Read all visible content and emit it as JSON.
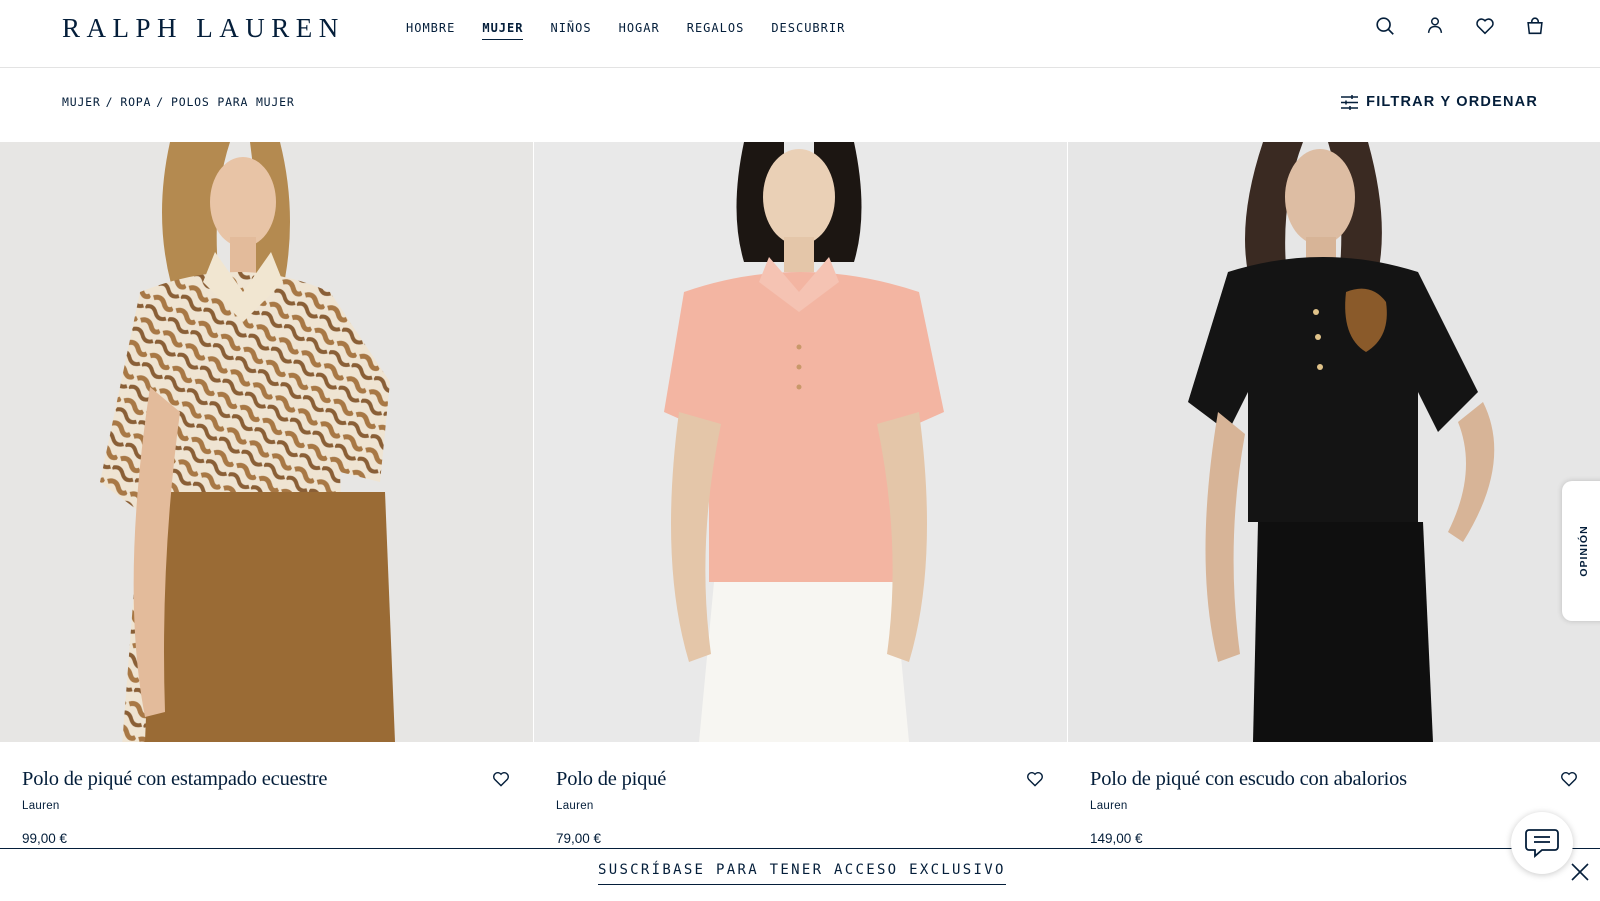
{
  "brand": {
    "logo_text": "RALPH LAUREN"
  },
  "nav": {
    "items": [
      {
        "label": "HOMBRE",
        "active": false
      },
      {
        "label": "MUJER",
        "active": true
      },
      {
        "label": "NIÑOS",
        "active": false
      },
      {
        "label": "HOGAR",
        "active": false
      },
      {
        "label": "REGALOS",
        "active": false
      },
      {
        "label": "DESCUBRIR",
        "active": false
      }
    ]
  },
  "header_icons": [
    "search-icon",
    "account-icon",
    "wishlist-heart-icon",
    "shopping-bag-icon"
  ],
  "breadcrumb": {
    "items": [
      "MUJER",
      "ROPA",
      "POLOS PARA MUJER"
    ],
    "separator": "/"
  },
  "filter": {
    "label": "FILTRAR Y ORDENAR",
    "icon": "sliders-icon"
  },
  "products": [
    {
      "name": "Polo de piqué con estampado ecuestre",
      "brand": "Lauren",
      "price": "99,00 €",
      "shirt_color": "#c89868",
      "pants_color": "#9a6b35"
    },
    {
      "name": "Polo de piqué",
      "brand": "Lauren",
      "price": "79,00 €",
      "shirt_color": "#f3b5a2",
      "pants_color": "#f7f6f2"
    },
    {
      "name": "Polo de piqué con escudo con abalorios",
      "brand": "Lauren",
      "price": "149,00 €",
      "shirt_color": "#141414",
      "pants_color": "#0f0f0f"
    }
  ],
  "feedback_tab": {
    "label": "OPINIÓN"
  },
  "promo": {
    "label": "SUSCRÍBASE PARA TENER ACCESO EXCLUSIVO"
  },
  "colors": {
    "navy": "#041e3a",
    "image_bg": "#e8e8e8",
    "background": "#ffffff"
  }
}
